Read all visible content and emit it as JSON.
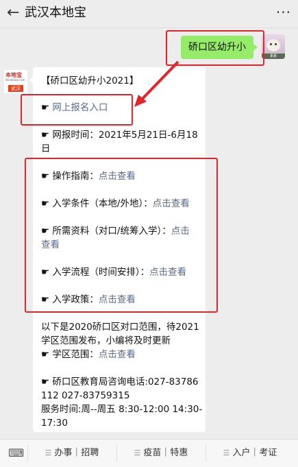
{
  "header": {
    "back_icon": "←",
    "title": "武汉本地宝",
    "more_icon": "···"
  },
  "user_message": "硚口区幼升小",
  "user_avatar_caption": "素素",
  "bot_avatar": {
    "logo_text": "本地宝",
    "logo_sub": "Bendibao.com",
    "city": "武汉"
  },
  "bot_message": {
    "title": "【硚口区幼升小2021】",
    "register": {
      "bullet": "☛",
      "label": "网上报名入口"
    },
    "time_line1": "☛ 网报时间：2021年5月21日-6月18",
    "time_line2": "日",
    "items": [
      {
        "bullet": "☛",
        "text": "操作指南：",
        "link": "点击查看"
      },
      {
        "bullet": "☛",
        "text": "入学条件（本地/外地）：",
        "link": "点击查看"
      },
      {
        "bullet": "☛",
        "text": "所需资料（对口/统筹入学）：",
        "link": "点击",
        "link2": "查看"
      },
      {
        "bullet": "☛",
        "text": "入学流程（时间安排）：",
        "link": "点击查看"
      },
      {
        "bullet": "☛",
        "text": "入学政策：",
        "link": "点击查看"
      }
    ],
    "note_line1": "以下是2020硚口区对口范围，待2021",
    "note_line2": "学区范围发布，小编将及时更新",
    "scope": {
      "bullet": "☛",
      "text": "学区范围：",
      "link": "点击查看"
    },
    "phone_line1": "☛ 硚口区教育局咨询电话:027-83786",
    "phone_line2": "112 027-83759315",
    "hours_line1": "服务时间:周--周五 8:30-12:00 14:30-",
    "hours_line2": "17:30"
  },
  "bottom_menu": {
    "keyboard_icon": "⌨",
    "items": [
      "办事｜招聘",
      "疫苗｜特惠",
      "入户｜考证"
    ]
  },
  "colors": {
    "bubble_green": "#95ec69",
    "link_blue": "#576b95",
    "highlight_red": "#e5242a"
  }
}
